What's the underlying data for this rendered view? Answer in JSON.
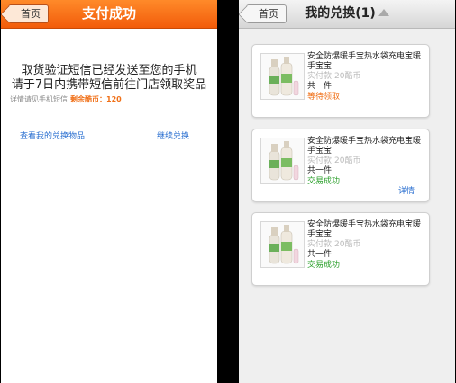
{
  "left_screen": {
    "back_label": "首页",
    "title": "支付成功",
    "message_line1": "取货验证短信已经发送至您的手机",
    "message_line2": "请于7日内携带短信前往门店领取奖品",
    "detail_text": "详情请见手机短信",
    "remaining_label": "剩余酷币：",
    "remaining_value": "120",
    "view_link": "查看我的兑换物品",
    "continue_link": "继续兑换"
  },
  "right_screen": {
    "back_label": "首页",
    "title": "我的兑换(1)",
    "title_icon": "triangle-up-icon",
    "orders": [
      {
        "name": "安全防爆暖手宝热水袋充电宝暖手宝宝",
        "price": "实付款:20酷币",
        "qty": "共一件",
        "status": "等待领取",
        "status_color": "#f07018",
        "detail_link": ""
      },
      {
        "name": "安全防爆暖手宝热水袋充电宝暖手宝宝",
        "price": "实付款:20酷币",
        "qty": "共一件",
        "status": "交易成功",
        "status_color": "#2ca02c",
        "detail_link": "详情"
      },
      {
        "name": "安全防爆暖手宝热水袋充电宝暖手宝宝",
        "price": "实付款:20酷币",
        "qty": "共一件",
        "status": "交易成功",
        "status_color": "#2ca02c",
        "detail_link": ""
      }
    ]
  },
  "colors": {
    "accent_orange": "#f25c0a",
    "link_blue": "#2a6fd0"
  }
}
